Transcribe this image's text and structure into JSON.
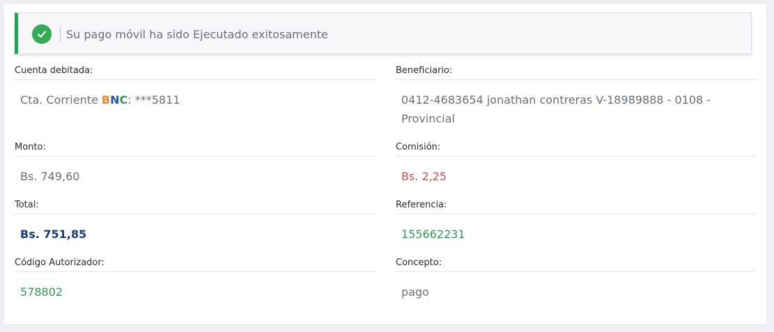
{
  "alert": {
    "message": "Su pago móvil ha sido Ejecutado exitosamente"
  },
  "fields": {
    "cuenta": {
      "label": "Cuenta debitada:",
      "prefix": "Cta. Corriente ",
      "bank_b": "B",
      "bank_n": "N",
      "bank_c": "C",
      "suffix": ": ***5811"
    },
    "beneficiario": {
      "label": "Beneficiario:",
      "value": "0412-4683654 jonathan contreras V-18989888 - 0108 - Provincial"
    },
    "monto": {
      "label": "Monto:",
      "value": "Bs. 749,60"
    },
    "comision": {
      "label": "Comisión:",
      "value": "Bs. 2,25"
    },
    "total": {
      "label": "Total:",
      "value": "Bs. 751,85"
    },
    "referencia": {
      "label": "Referencia:",
      "value": "155662231"
    },
    "codigo": {
      "label": "Código Autorizador:",
      "value": "578802"
    },
    "concepto": {
      "label": "Concepto:",
      "value": "pago"
    }
  },
  "colors": {
    "success": "#35aa54",
    "commission": "#d64a4a",
    "total": "#163d7a",
    "reference": "#2e9a58",
    "bnc_b": "#f0851c",
    "bnc_n": "#1f5aa8",
    "bnc_c": "#2e9a58"
  }
}
